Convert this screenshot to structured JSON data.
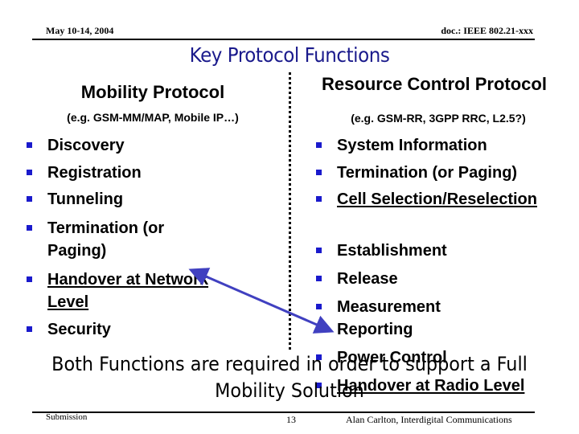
{
  "header": {
    "date": "May 10-14, 2004",
    "doc_id": "doc.: IEEE 802.21-xxx"
  },
  "slide": {
    "title": "Key Protocol Functions",
    "title_color": "#1a1a8c",
    "bullet_color": "#1a1acc",
    "arrow_color": "#4040c0"
  },
  "left_column": {
    "heading": "Mobility Protocol",
    "subheading": "(e.g. GSM-MM/MAP, Mobile IP…)",
    "items": [
      {
        "text": "Discovery",
        "underlined": false
      },
      {
        "text": "Registration",
        "underlined": false
      },
      {
        "text": "Tunneling",
        "underlined": false
      },
      {
        "text": "Termination (or Paging)",
        "underlined": false
      },
      {
        "text": "Handover at Network Level",
        "underlined": true
      },
      {
        "text": "Security",
        "underlined": false
      }
    ]
  },
  "right_column": {
    "heading": "Resource Control Protocol",
    "subheading": "(e.g. GSM-RR, 3GPP RRC, L2.5?)",
    "items": [
      {
        "text": "System Information",
        "underlined": false
      },
      {
        "text": "Termination (or Paging)",
        "underlined": false
      },
      {
        "text": "Cell Selection/Reselection",
        "underlined": true
      },
      {
        "text": "Establishment",
        "underlined": false
      },
      {
        "text": "Release",
        "underlined": false
      },
      {
        "text": "Measurement Reporting",
        "underlined": false
      },
      {
        "text": "Power Control",
        "underlined": false
      },
      {
        "text": "Handover at Radio Level",
        "underlined": true
      }
    ]
  },
  "conclusion": "Both Functions are required in order to support a Full Mobility Solution",
  "footer": {
    "left": "Submission",
    "page_number": "13",
    "author": "Alan Carlton, Interdigital Communications"
  }
}
